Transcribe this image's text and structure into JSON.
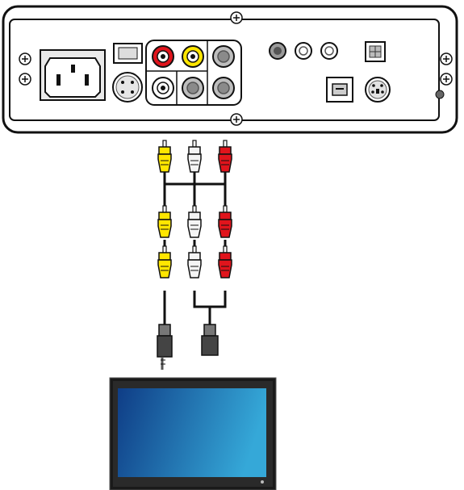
{
  "colors": {
    "red_plug": "#e0141c",
    "yellow_plug": "#ffe600",
    "white_plug": "#f4f4f4",
    "panel_bg": "#ffffff",
    "outline": "#111111",
    "screen_dark": "#0f3d86",
    "screen_light": "#35a8d8",
    "tv_frame": "#1a1a1a",
    "connector_gray": "#9a9a9a"
  },
  "device": {
    "name_icon": "media-player-rear-panel",
    "ports": [
      "power-inlet-icon",
      "power-switch-icon",
      "dc-4pin-icon",
      "rca-red-jack-icon",
      "rca-yellow-jack-icon",
      "rca-gray-jack-icon",
      "rca-white-jack-icon",
      "optical-jack-icon",
      "usb-b-port-icon",
      "s-video-port-icon",
      "reset-hole-icon"
    ]
  },
  "cables": {
    "top_plugs": [
      "yellow",
      "white",
      "red"
    ],
    "middle_plugs": [
      "yellow",
      "white",
      "red"
    ],
    "lower_plugs": [
      "yellow",
      "white",
      "red"
    ],
    "end_connectors": [
      "video-jack",
      "audio-jack"
    ]
  },
  "tv": {
    "icon": "flat-screen-tv-icon"
  }
}
